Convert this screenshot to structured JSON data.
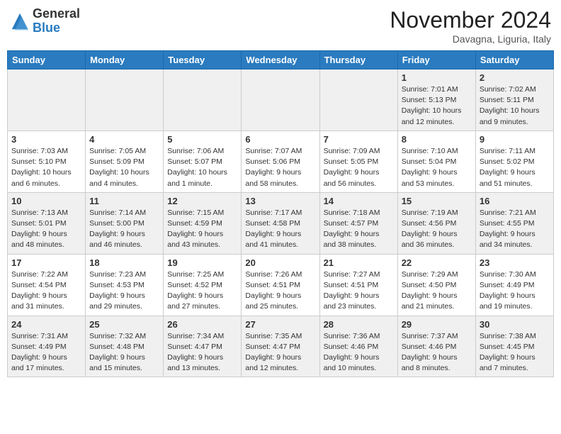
{
  "header": {
    "logo_line1": "General",
    "logo_line2": "Blue",
    "month": "November 2024",
    "location": "Davagna, Liguria, Italy"
  },
  "days_of_week": [
    "Sunday",
    "Monday",
    "Tuesday",
    "Wednesday",
    "Thursday",
    "Friday",
    "Saturday"
  ],
  "weeks": [
    [
      {
        "day": "",
        "info": ""
      },
      {
        "day": "",
        "info": ""
      },
      {
        "day": "",
        "info": ""
      },
      {
        "day": "",
        "info": ""
      },
      {
        "day": "",
        "info": ""
      },
      {
        "day": "1",
        "info": "Sunrise: 7:01 AM\nSunset: 5:13 PM\nDaylight: 10 hours and 12 minutes."
      },
      {
        "day": "2",
        "info": "Sunrise: 7:02 AM\nSunset: 5:11 PM\nDaylight: 10 hours and 9 minutes."
      }
    ],
    [
      {
        "day": "3",
        "info": "Sunrise: 7:03 AM\nSunset: 5:10 PM\nDaylight: 10 hours and 6 minutes."
      },
      {
        "day": "4",
        "info": "Sunrise: 7:05 AM\nSunset: 5:09 PM\nDaylight: 10 hours and 4 minutes."
      },
      {
        "day": "5",
        "info": "Sunrise: 7:06 AM\nSunset: 5:07 PM\nDaylight: 10 hours and 1 minute."
      },
      {
        "day": "6",
        "info": "Sunrise: 7:07 AM\nSunset: 5:06 PM\nDaylight: 9 hours and 58 minutes."
      },
      {
        "day": "7",
        "info": "Sunrise: 7:09 AM\nSunset: 5:05 PM\nDaylight: 9 hours and 56 minutes."
      },
      {
        "day": "8",
        "info": "Sunrise: 7:10 AM\nSunset: 5:04 PM\nDaylight: 9 hours and 53 minutes."
      },
      {
        "day": "9",
        "info": "Sunrise: 7:11 AM\nSunset: 5:02 PM\nDaylight: 9 hours and 51 minutes."
      }
    ],
    [
      {
        "day": "10",
        "info": "Sunrise: 7:13 AM\nSunset: 5:01 PM\nDaylight: 9 hours and 48 minutes."
      },
      {
        "day": "11",
        "info": "Sunrise: 7:14 AM\nSunset: 5:00 PM\nDaylight: 9 hours and 46 minutes."
      },
      {
        "day": "12",
        "info": "Sunrise: 7:15 AM\nSunset: 4:59 PM\nDaylight: 9 hours and 43 minutes."
      },
      {
        "day": "13",
        "info": "Sunrise: 7:17 AM\nSunset: 4:58 PM\nDaylight: 9 hours and 41 minutes."
      },
      {
        "day": "14",
        "info": "Sunrise: 7:18 AM\nSunset: 4:57 PM\nDaylight: 9 hours and 38 minutes."
      },
      {
        "day": "15",
        "info": "Sunrise: 7:19 AM\nSunset: 4:56 PM\nDaylight: 9 hours and 36 minutes."
      },
      {
        "day": "16",
        "info": "Sunrise: 7:21 AM\nSunset: 4:55 PM\nDaylight: 9 hours and 34 minutes."
      }
    ],
    [
      {
        "day": "17",
        "info": "Sunrise: 7:22 AM\nSunset: 4:54 PM\nDaylight: 9 hours and 31 minutes."
      },
      {
        "day": "18",
        "info": "Sunrise: 7:23 AM\nSunset: 4:53 PM\nDaylight: 9 hours and 29 minutes."
      },
      {
        "day": "19",
        "info": "Sunrise: 7:25 AM\nSunset: 4:52 PM\nDaylight: 9 hours and 27 minutes."
      },
      {
        "day": "20",
        "info": "Sunrise: 7:26 AM\nSunset: 4:51 PM\nDaylight: 9 hours and 25 minutes."
      },
      {
        "day": "21",
        "info": "Sunrise: 7:27 AM\nSunset: 4:51 PM\nDaylight: 9 hours and 23 minutes."
      },
      {
        "day": "22",
        "info": "Sunrise: 7:29 AM\nSunset: 4:50 PM\nDaylight: 9 hours and 21 minutes."
      },
      {
        "day": "23",
        "info": "Sunrise: 7:30 AM\nSunset: 4:49 PM\nDaylight: 9 hours and 19 minutes."
      }
    ],
    [
      {
        "day": "24",
        "info": "Sunrise: 7:31 AM\nSunset: 4:49 PM\nDaylight: 9 hours and 17 minutes."
      },
      {
        "day": "25",
        "info": "Sunrise: 7:32 AM\nSunset: 4:48 PM\nDaylight: 9 hours and 15 minutes."
      },
      {
        "day": "26",
        "info": "Sunrise: 7:34 AM\nSunset: 4:47 PM\nDaylight: 9 hours and 13 minutes."
      },
      {
        "day": "27",
        "info": "Sunrise: 7:35 AM\nSunset: 4:47 PM\nDaylight: 9 hours and 12 minutes."
      },
      {
        "day": "28",
        "info": "Sunrise: 7:36 AM\nSunset: 4:46 PM\nDaylight: 9 hours and 10 minutes."
      },
      {
        "day": "29",
        "info": "Sunrise: 7:37 AM\nSunset: 4:46 PM\nDaylight: 9 hours and 8 minutes."
      },
      {
        "day": "30",
        "info": "Sunrise: 7:38 AM\nSunset: 4:45 PM\nDaylight: 9 hours and 7 minutes."
      }
    ]
  ]
}
